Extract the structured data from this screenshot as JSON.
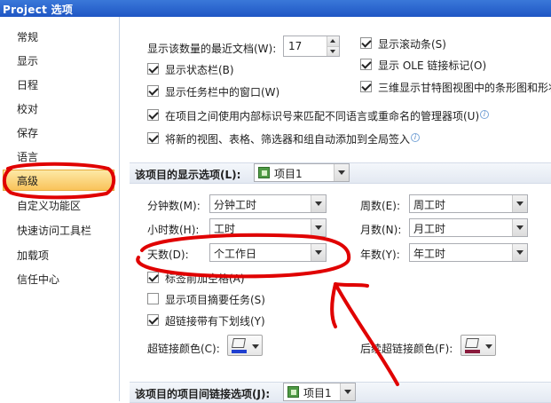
{
  "window": {
    "title": "Project 选项"
  },
  "sidebar": {
    "items": [
      {
        "label": "常规"
      },
      {
        "label": "显示"
      },
      {
        "label": "日程"
      },
      {
        "label": "校对"
      },
      {
        "label": "保存"
      },
      {
        "label": "语言"
      },
      {
        "label": "高级",
        "selected": true
      },
      {
        "label": "自定义功能区"
      },
      {
        "label": "快速访问工具栏"
      },
      {
        "label": "加载项"
      },
      {
        "label": "信任中心"
      }
    ]
  },
  "display": {
    "recent_docs_label": "显示该数量的最近文档(W):",
    "recent_docs_value": "17",
    "show_statusbar": {
      "label": "显示状态栏(B)",
      "checked": true
    },
    "show_taskbar_windows": {
      "label": "显示任务栏中的窗口(W)",
      "checked": true
    },
    "show_scrollbars": {
      "label": "显示滚动条(S)",
      "checked": true
    },
    "show_ole_links": {
      "label": "显示 OLE 链接标记(O)",
      "checked": true
    },
    "gantt_3d": {
      "label": "三维显示甘特图视图中的条形图和形状",
      "checked": true
    },
    "internal_ids": {
      "label": "在项目之间使用内部标识号来匹配不同语言或重命名的管理器项(U)",
      "checked": true
    },
    "add_new_to_global": {
      "label": "将新的视图、表格、筛选器和组自动添加到全局签入",
      "checked": true
    }
  },
  "project_display": {
    "header": "该项目的显示选项(L):",
    "project_name": "项目1",
    "minutes_label": "分钟数(M):",
    "minutes_value": "分钟工时",
    "hours_label": "小时数(H):",
    "hours_value": "工时",
    "days_label": "天数(D):",
    "days_value": "个工作日",
    "weeks_label": "周数(E):",
    "weeks_value": "周工时",
    "months_label": "月数(N):",
    "months_value": "月工时",
    "years_label": "年数(Y):",
    "years_value": "年工时",
    "space_before_label": {
      "label": "标签前加空格(A)",
      "checked": true
    },
    "show_summary_task": {
      "label": "显示项目摘要任务(S)",
      "checked": false
    },
    "underline_hyperlinks": {
      "label": "超链接带有下划线(Y)",
      "checked": true
    },
    "hyperlink_color_label": "超链接颜色(C):",
    "hyperlink_color": "#1f3fd0",
    "followed_color_label": "后续超链接颜色(F):",
    "followed_color": "#8a1a3c"
  },
  "cross_project": {
    "header": "该项目的项目间链接选项(J):",
    "project_name": "项目1"
  },
  "annotation": {
    "color": "#e00000"
  }
}
